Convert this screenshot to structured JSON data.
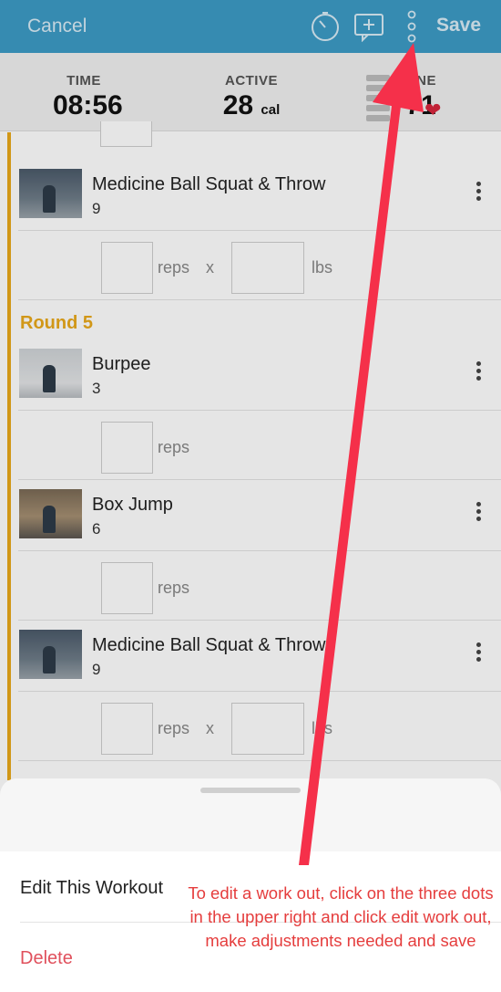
{
  "navbar": {
    "cancel_label": "Cancel",
    "save_label": "Save",
    "icons": [
      "timer-icon",
      "add-comment-icon",
      "more-vertical-icon"
    ],
    "accent": "#3d9bc6"
  },
  "stats": {
    "time_label": "TIME",
    "time_value": "08:56",
    "active_label": "ACTIVE",
    "active_value": "28",
    "active_unit": "cal",
    "zone_label": "ONE",
    "zone_value": "71"
  },
  "workout": {
    "round_color": "#e9a91b",
    "round5_title": "Round 5",
    "exercises": [
      {
        "name": "Medicine Ball Squat & Throw",
        "count": "9"
      },
      {
        "name": "Burpee",
        "count": "3"
      },
      {
        "name": "Box Jump",
        "count": "6"
      },
      {
        "name": "Medicine Ball Squat & Throw",
        "count": "9"
      }
    ],
    "reps_label": "reps",
    "times_label": "x",
    "lbs_label": "lbs",
    "lbs_label_partial": "l"
  },
  "sheet": {
    "edit_label": "Edit This Workout",
    "delete_label": "Delete",
    "delete_color": "#e0505c"
  },
  "annotation": {
    "text": "To edit a work out, click on the three dots in the upper right and click edit work out, make adjustments needed and save",
    "color": "#f5304a"
  }
}
